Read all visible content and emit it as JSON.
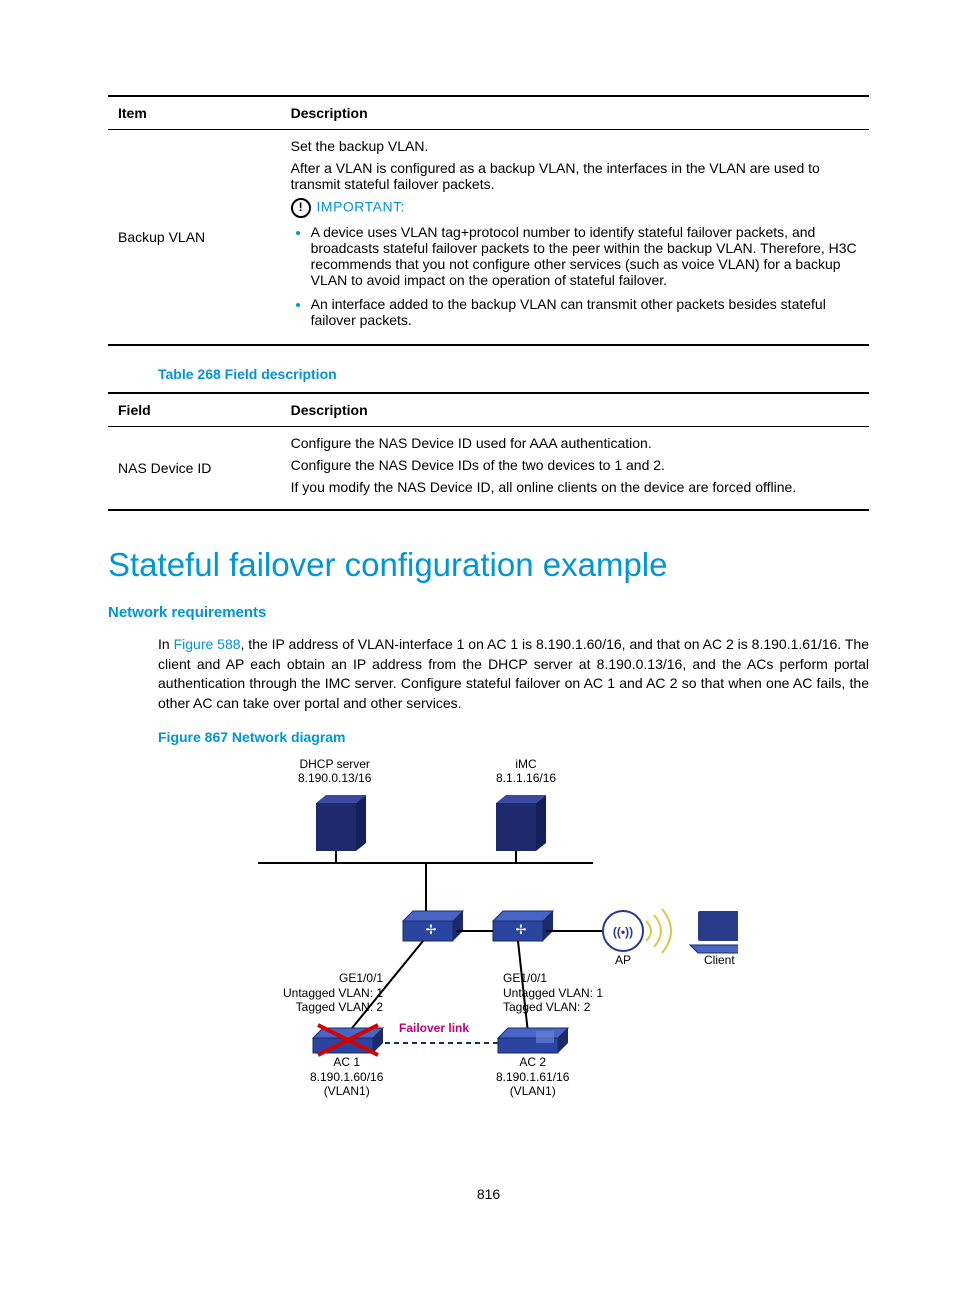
{
  "table1": {
    "headers": {
      "item": "Item",
      "desc": "Description"
    },
    "row": {
      "item": "Backup VLAN",
      "p1": "Set the backup VLAN.",
      "p2": "After a VLAN is configured as a backup VLAN, the interfaces in the VLAN are used to transmit stateful failover packets.",
      "important_label": "IMPORTANT:",
      "bullet1": "A device uses VLAN tag+protocol number to identify stateful failover packets, and broadcasts stateful failover packets to the peer within the backup VLAN. Therefore, H3C recommends that you not configure other services (such as voice VLAN) for a backup VLAN to avoid impact on the operation of stateful failover.",
      "bullet2": "An interface added to the backup VLAN can transmit other packets besides stateful failover packets."
    }
  },
  "caption2": "Table 268 Field description",
  "table2": {
    "headers": {
      "field": "Field",
      "desc": "Description"
    },
    "row": {
      "field": "NAS Device ID",
      "p1": "Configure the NAS Device ID used for AAA authentication.",
      "p2": "Configure the NAS Device IDs of the two devices to 1 and 2.",
      "p3": "If you modify the NAS Device ID, all online clients on the device are forced offline."
    }
  },
  "section_title": "Stateful failover configuration example",
  "subheading": "Network requirements",
  "para_pre": "In ",
  "fig_link": "Figure 588",
  "para_post": ", the IP address of VLAN-interface 1 on AC 1 is 8.190.1.60/16, and that on AC 2 is 8.190.1.61/16. The client and AP each obtain an IP address from the DHCP server at 8.190.0.13/16, and the ACs perform portal authentication through the IMC server. Configure stateful failover on AC 1 and AC 2 so that when one AC fails, the other AC can take over portal and other services.",
  "figure_caption": "Figure 867 Network diagram",
  "diagram": {
    "dhcp": {
      "name": "DHCP server",
      "ip": "8.190.0.13/16"
    },
    "imc": {
      "name": "iMC",
      "ip": "8.1.1.16/16"
    },
    "ap": "AP",
    "client": "Client",
    "ge_left": {
      "l1": "GE1/0/1",
      "l2": "Untagged VLAN: 1",
      "l3": "Tagged VLAN: 2"
    },
    "ge_right": {
      "l1": "GE1/0/1",
      "l2": "Untagged VLAN: 1",
      "l3": "Tagged VLAN: 2"
    },
    "failover": "Failover link",
    "ac1": {
      "name": "AC 1",
      "ip": "8.190.1.60/16",
      "vlan": "(VLAN1)"
    },
    "ac2": {
      "name": "AC 2",
      "ip": "8.190.1.61/16",
      "vlan": "(VLAN1)"
    }
  },
  "page_num": "816"
}
